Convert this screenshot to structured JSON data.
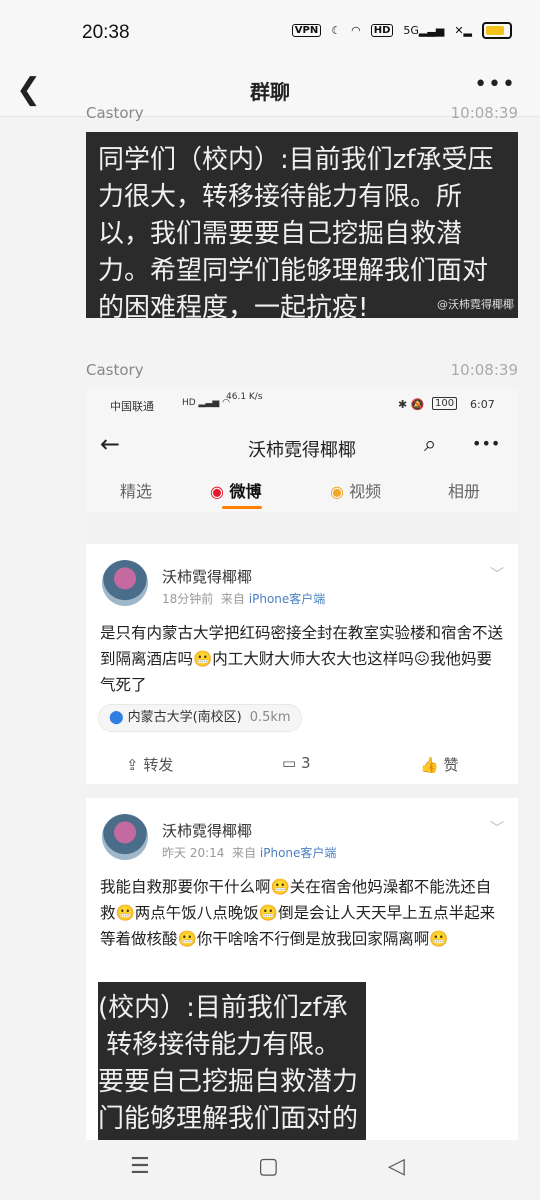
{
  "status_bar": {
    "time": "20:38",
    "vpn": "VPN",
    "hd": "HD",
    "network": "5G"
  },
  "header": {
    "back_icon": "chevron-left-icon",
    "title": "群聊",
    "more_label": "•••"
  },
  "messages": [
    {
      "sender": "Castory",
      "time": "10:08:39",
      "image_text": "同学们（校内）:目前我们zf承受压力很大，转移接待能力有限。所以，我们需要要自己挖掘自救潜力。希望同学们能够理解我们面对的困难程度，一起抗疫!",
      "watermark": "@沃柿霓得椰椰"
    },
    {
      "sender": "Castory",
      "time": "10:08:39"
    }
  ],
  "screenshot": {
    "status": {
      "carrier": "中国联通",
      "speed": "46.1 K/s",
      "battery": "100",
      "time": "6:07"
    },
    "title": "沃柿霓得椰椰",
    "tabs": [
      {
        "label": "精选",
        "active": false
      },
      {
        "label": "微博",
        "active": true
      },
      {
        "label": "视频",
        "active": false
      },
      {
        "label": "相册",
        "active": false
      }
    ],
    "posts": [
      {
        "user": "沃柿霓得椰椰",
        "time": "18分钟前",
        "from": "来自",
        "source": "iPhone客户端",
        "text": "是只有内蒙古大学把红码密接全封在教室实验楼和宿舍不送到隔离酒店吗😬内工大财大师大农大也这样吗😖我他妈要气死了",
        "location": "内蒙古大学(南校区)",
        "distance": "0.5km",
        "repost_label": "转发",
        "comment_count": "3",
        "like_label": "赞"
      },
      {
        "user": "沃柿霓得椰椰",
        "time": "昨天 20:14",
        "from": "来自",
        "source": "iPhone客户端",
        "text": "我能自救那要你干什么啊😬关在宿舍他妈澡都不能洗还自救😬两点午饭八点晚饭😬倒是会让人天天早上五点半起来等着做核酸😬你干啥啥不行倒是放我回家隔离啊😬",
        "image_text": "(校内）:目前我们zf承\n 转移接待能力有限。\n要要自己挖掘自救潜力\n门能够理解我们面对的"
      }
    ]
  }
}
